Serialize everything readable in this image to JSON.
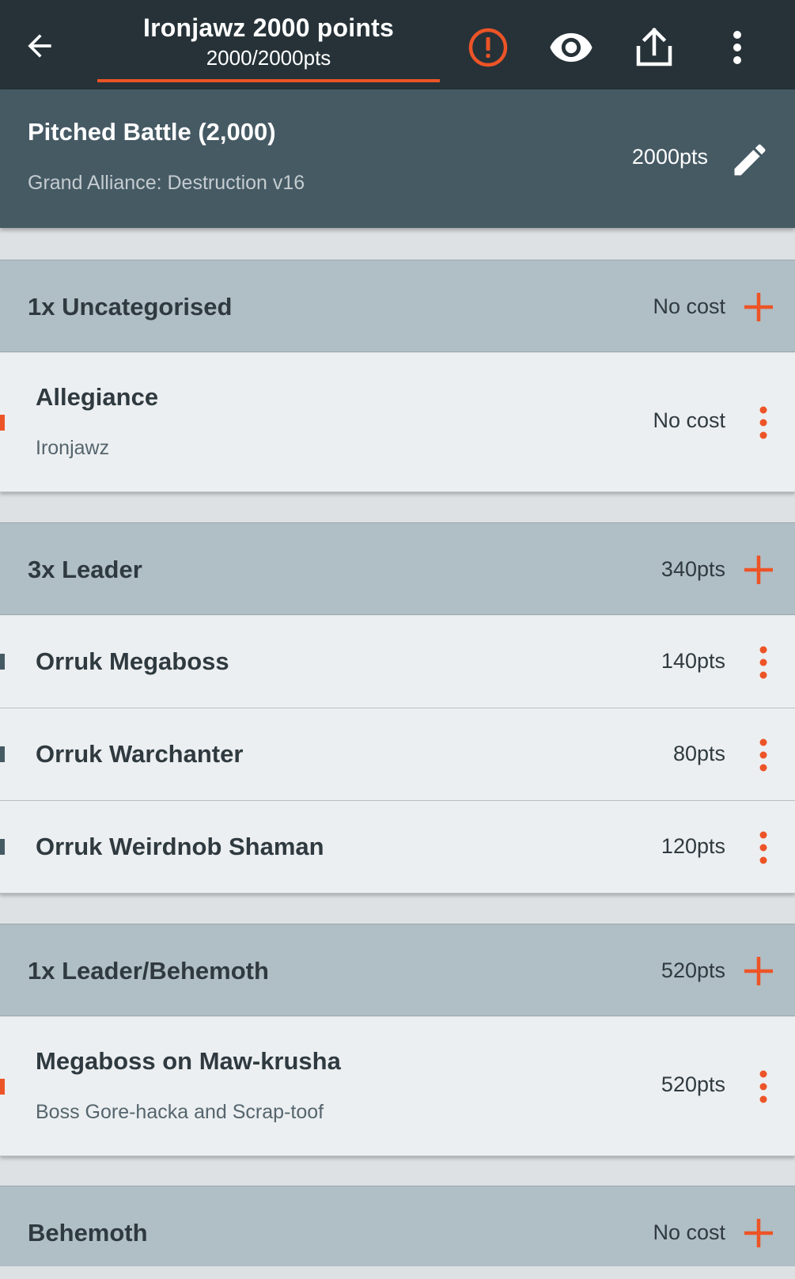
{
  "appbar": {
    "title": "Ironjawz 2000 points",
    "points": "2000/2000pts"
  },
  "battle": {
    "name": "Pitched Battle (2,000)",
    "faction": "Grand Alliance: Destruction v16",
    "points": "2000pts"
  },
  "categories": [
    {
      "label": "1x Uncategorised",
      "cost": "No cost",
      "items": [
        {
          "name": "Allegiance",
          "sub": "Ironjawz",
          "cost": "No cost",
          "marker": "orange"
        }
      ]
    },
    {
      "label": "3x Leader",
      "cost": "340pts",
      "items": [
        {
          "name": "Orruk Megaboss",
          "cost": "140pts",
          "marker": "slate"
        },
        {
          "name": "Orruk Warchanter",
          "cost": "80pts",
          "marker": "slate"
        },
        {
          "name": "Orruk Weirdnob Shaman",
          "cost": "120pts",
          "marker": "slate"
        }
      ]
    },
    {
      "label": "1x Leader/Behemoth",
      "cost": "520pts",
      "items": [
        {
          "name": "Megaboss on Maw-krusha",
          "sub": "Boss Gore-hacka and Scrap-toof",
          "cost": "520pts",
          "marker": "orange"
        }
      ]
    },
    {
      "label": "Behemoth",
      "cost": "No cost",
      "items": []
    }
  ],
  "icons": {
    "back": "arrow-left-icon",
    "warning": "alert-circle-icon",
    "preview": "eye-icon",
    "share": "share-icon",
    "menu": "more-vert-icon",
    "edit": "pencil-icon",
    "add": "plus-icon",
    "item_menu": "more-vert-icon"
  },
  "colors": {
    "appbar": "#263238",
    "accent": "#ec5427",
    "battle_header": "#465a64",
    "category": "#b0bec5",
    "item": "#eceff1",
    "marker_orange": "#ec5427",
    "marker_slate": "#465a64"
  }
}
